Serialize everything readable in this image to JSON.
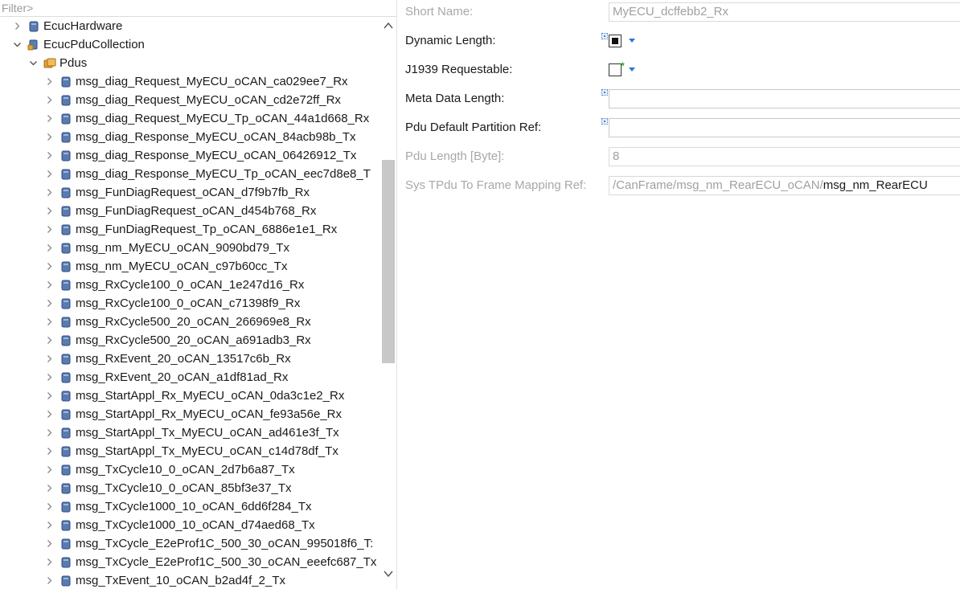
{
  "filter": {
    "placeholder": "Filter>"
  },
  "tree": [
    {
      "label": "EcucHardware",
      "indent": 0,
      "chevron": "right",
      "icon": "container-icon"
    },
    {
      "label": "EcucPduCollection",
      "indent": 0,
      "chevron": "down",
      "icon": "collection-icon"
    },
    {
      "label": "Pdus",
      "indent": 1,
      "chevron": "down",
      "icon": "folder-icon"
    },
    {
      "label": "msg_diag_Request_MyECU_oCAN_ca029ee7_Rx",
      "indent": 2,
      "chevron": "right",
      "icon": "pdu-icon"
    },
    {
      "label": "msg_diag_Request_MyECU_oCAN_cd2e72ff_Rx",
      "indent": 2,
      "chevron": "right",
      "icon": "pdu-icon"
    },
    {
      "label": "msg_diag_Request_MyECU_Tp_oCAN_44a1d668_Rx",
      "indent": 2,
      "chevron": "right",
      "icon": "pdu-icon"
    },
    {
      "label": "msg_diag_Response_MyECU_oCAN_84acb98b_Tx",
      "indent": 2,
      "chevron": "right",
      "icon": "pdu-icon"
    },
    {
      "label": "msg_diag_Response_MyECU_oCAN_06426912_Tx",
      "indent": 2,
      "chevron": "right",
      "icon": "pdu-icon"
    },
    {
      "label": "msg_diag_Response_MyECU_Tp_oCAN_eec7d8e8_T",
      "indent": 2,
      "chevron": "right",
      "icon": "pdu-icon"
    },
    {
      "label": "msg_FunDiagRequest_oCAN_d7f9b7fb_Rx",
      "indent": 2,
      "chevron": "right",
      "icon": "pdu-icon"
    },
    {
      "label": "msg_FunDiagRequest_oCAN_d454b768_Rx",
      "indent": 2,
      "chevron": "right",
      "icon": "pdu-icon"
    },
    {
      "label": "msg_FunDiagRequest_Tp_oCAN_6886e1e1_Rx",
      "indent": 2,
      "chevron": "right",
      "icon": "pdu-icon"
    },
    {
      "label": "msg_nm_MyECU_oCAN_9090bd79_Tx",
      "indent": 2,
      "chevron": "right",
      "icon": "pdu-icon"
    },
    {
      "label": "msg_nm_MyECU_oCAN_c97b60cc_Tx",
      "indent": 2,
      "chevron": "right",
      "icon": "pdu-icon"
    },
    {
      "label": "msg_RxCycle100_0_oCAN_1e247d16_Rx",
      "indent": 2,
      "chevron": "right",
      "icon": "pdu-icon"
    },
    {
      "label": "msg_RxCycle100_0_oCAN_c71398f9_Rx",
      "indent": 2,
      "chevron": "right",
      "icon": "pdu-icon"
    },
    {
      "label": "msg_RxCycle500_20_oCAN_266969e8_Rx",
      "indent": 2,
      "chevron": "right",
      "icon": "pdu-icon"
    },
    {
      "label": "msg_RxCycle500_20_oCAN_a691adb3_Rx",
      "indent": 2,
      "chevron": "right",
      "icon": "pdu-icon"
    },
    {
      "label": "msg_RxEvent_20_oCAN_13517c6b_Rx",
      "indent": 2,
      "chevron": "right",
      "icon": "pdu-icon"
    },
    {
      "label": "msg_RxEvent_20_oCAN_a1df81ad_Rx",
      "indent": 2,
      "chevron": "right",
      "icon": "pdu-icon"
    },
    {
      "label": "msg_StartAppl_Rx_MyECU_oCAN_0da3c1e2_Rx",
      "indent": 2,
      "chevron": "right",
      "icon": "pdu-icon"
    },
    {
      "label": "msg_StartAppl_Rx_MyECU_oCAN_fe93a56e_Rx",
      "indent": 2,
      "chevron": "right",
      "icon": "pdu-icon"
    },
    {
      "label": "msg_StartAppl_Tx_MyECU_oCAN_ad461e3f_Tx",
      "indent": 2,
      "chevron": "right",
      "icon": "pdu-icon"
    },
    {
      "label": "msg_StartAppl_Tx_MyECU_oCAN_c14d78df_Tx",
      "indent": 2,
      "chevron": "right",
      "icon": "pdu-icon"
    },
    {
      "label": "msg_TxCycle10_0_oCAN_2d7b6a87_Tx",
      "indent": 2,
      "chevron": "right",
      "icon": "pdu-icon"
    },
    {
      "label": "msg_TxCycle10_0_oCAN_85bf3e37_Tx",
      "indent": 2,
      "chevron": "right",
      "icon": "pdu-icon"
    },
    {
      "label": "msg_TxCycle1000_10_oCAN_6dd6f284_Tx",
      "indent": 2,
      "chevron": "right",
      "icon": "pdu-icon"
    },
    {
      "label": "msg_TxCycle1000_10_oCAN_d74aed68_Tx",
      "indent": 2,
      "chevron": "right",
      "icon": "pdu-icon"
    },
    {
      "label": "msg_TxCycle_E2eProf1C_500_30_oCAN_995018f6_T:",
      "indent": 2,
      "chevron": "right",
      "icon": "pdu-icon"
    },
    {
      "label": "msg_TxCycle_E2eProf1C_500_30_oCAN_eeefc687_Tx",
      "indent": 2,
      "chevron": "right",
      "icon": "pdu-icon"
    },
    {
      "label": "msg_TxEvent_10_oCAN_b2ad4f_2_Tx",
      "indent": 2,
      "chevron": "right",
      "icon": "pdu-icon"
    }
  ],
  "properties": {
    "short_name": {
      "label": "Short Name:",
      "value": "MyECU_dcffebb2_Rx"
    },
    "dynamic_length": {
      "label": "Dynamic Length:",
      "checked": true
    },
    "j1939_requestable": {
      "label": "J1939 Requestable:",
      "checked": false
    },
    "meta_data_length": {
      "label": "Meta Data Length:",
      "value": ""
    },
    "pdu_default_partition_ref": {
      "label": "Pdu Default Partition Ref:",
      "value": ""
    },
    "pdu_length": {
      "label": "Pdu Length [Byte]:",
      "value": "8"
    },
    "sys_tpdu_mapping": {
      "label": "Sys TPdu To Frame Mapping Ref:",
      "path_prefix": "/CanFrame/msg_nm_RearECU_oCAN/",
      "path_leaf": "msg_nm_RearECU"
    }
  },
  "colors": {
    "accent": "#2b78d6",
    "pdu_icon": "#4a6a9c",
    "folder_icon": "#e0a23a",
    "modified_mark": "#2aa52a"
  }
}
